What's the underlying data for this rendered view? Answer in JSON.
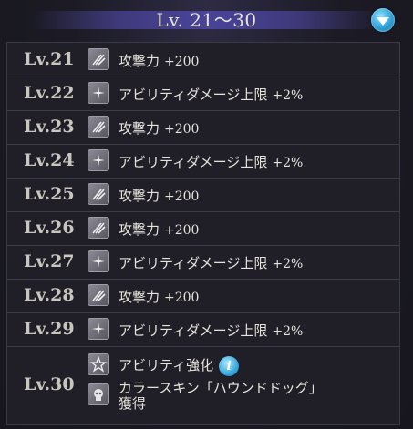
{
  "header": {
    "title": "Lv. 21～30"
  },
  "rows": [
    {
      "level": "Lv.21",
      "icon": "attack-icon",
      "text": "攻撃力",
      "value": "+200"
    },
    {
      "level": "Lv.22",
      "icon": "ability-spark-icon",
      "text": "アビリティダメージ上限",
      "value": "+2%"
    },
    {
      "level": "Lv.23",
      "icon": "attack-icon",
      "text": "攻撃力",
      "value": "+200"
    },
    {
      "level": "Lv.24",
      "icon": "ability-spark-icon",
      "text": "アビリティダメージ上限",
      "value": "+2%"
    },
    {
      "level": "Lv.25",
      "icon": "attack-icon",
      "text": "攻撃力",
      "value": "+200"
    },
    {
      "level": "Lv.26",
      "icon": "attack-icon",
      "text": "攻撃力",
      "value": "+200"
    },
    {
      "level": "Lv.27",
      "icon": "ability-spark-icon",
      "text": "アビリティダメージ上限",
      "value": "+2%"
    },
    {
      "level": "Lv.28",
      "icon": "attack-icon",
      "text": "攻撃力",
      "value": "+200"
    },
    {
      "level": "Lv.29",
      "icon": "ability-spark-icon",
      "text": "アビリティダメージ上限",
      "value": "+2%"
    }
  ],
  "last_row": {
    "level": "Lv.30",
    "ability": {
      "icon": "ability-star-icon",
      "text": "アビリティ強化",
      "info_icon": "info-icon"
    },
    "skin": {
      "icon": "skin-icon",
      "line1": "カラースキン「ハウンドドッグ」",
      "line2": "獲得"
    }
  },
  "colors": {
    "background": "#1b1a22",
    "header_bar": "#4a449a",
    "accent_blue": "#2d9fd6",
    "text": "#e6e3da",
    "level_text": "#c9c6bd"
  }
}
